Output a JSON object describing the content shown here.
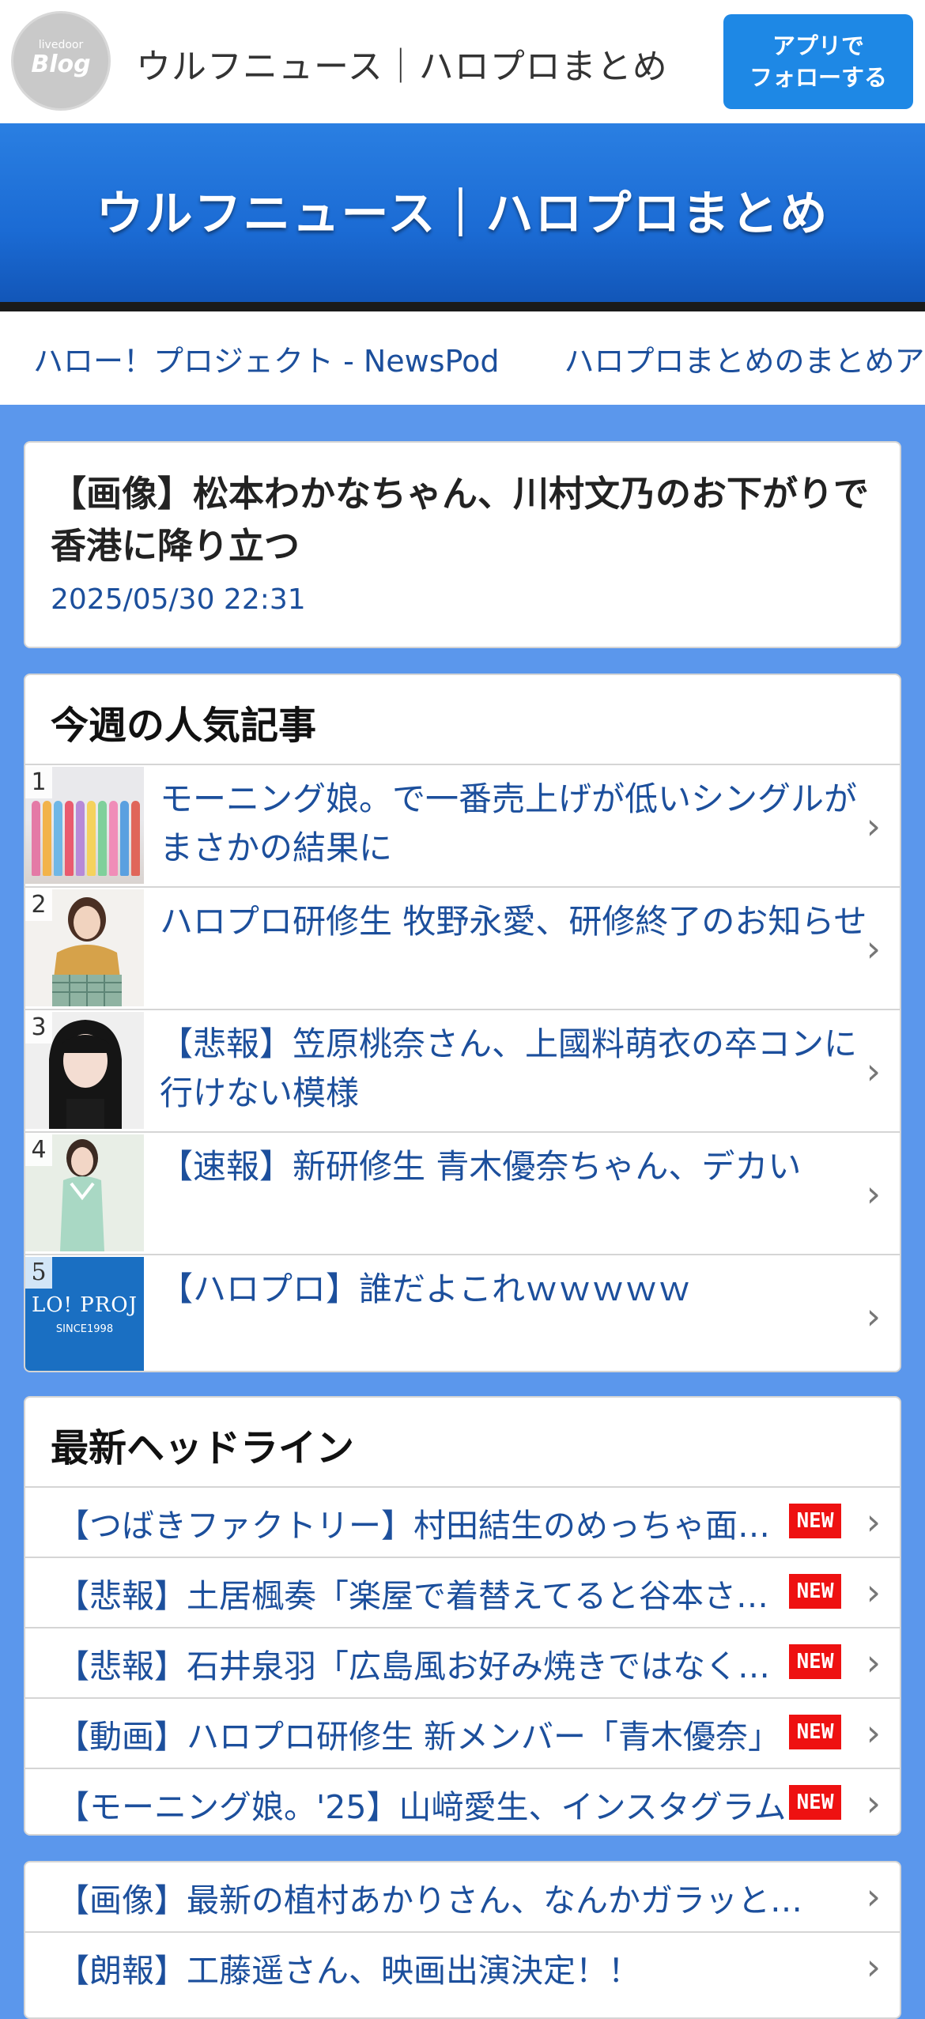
{
  "topbar": {
    "logo_small": "livedoor",
    "logo_big": "Blog",
    "site_name": "ウルフニュース｜ハロプロまとめ",
    "follow_line1": "アプリで",
    "follow_line2": "フォローする"
  },
  "hero": {
    "title": "ウルフニュース｜ハロプロまとめ"
  },
  "nav": {
    "links": [
      "ハロー！プロジェクト - NewsPod",
      "ハロプロまとめのまとめアンテナ"
    ]
  },
  "article": {
    "title": "【画像】松本わかなちゃん、川村文乃のお下がりで香港に降り立つ",
    "date": "2025/05/30 22:31"
  },
  "popular": {
    "title": "今週の人気記事",
    "items": [
      {
        "rank": "1",
        "text": "モーニング娘。で一番売上げが低いシングルがまさかの結果に"
      },
      {
        "rank": "2",
        "text": "ハロプロ研修生 牧野永愛、研修終了のお知らせ"
      },
      {
        "rank": "3",
        "text": "【悲報】笠原桃奈さん、上國料萌衣の卒コンに行けない模様"
      },
      {
        "rank": "4",
        "text": "【速報】新研修生 青木優奈ちゃん、デカい"
      },
      {
        "rank": "5",
        "text": "【ハロプロ】誰だよこれｗｗｗｗｗ"
      }
    ],
    "thumb5_line1": "LO! PROJ",
    "thumb5_line2": "SINCE1998"
  },
  "headlines": {
    "title": "最新ヘッドライン",
    "badge": "NEW",
    "items": [
      "【つばきファクトリー】村田結生のめっちゃ面白い",
      "【悲報】土居楓奏「楽屋で着替えてると谷本さんが",
      "【悲報】石井泉羽「広島風お好み焼きではなく広島",
      "【動画】ハロプロ研修生 新メンバー「青木優奈」",
      "【モーニング娘。'25】山﨑愛生、インスタグラム"
    ]
  },
  "more": {
    "items": [
      "【画像】最新の植村あかりさん、なんかガラッと変わる",
      "【朗報】工藤遥さん、映画出演決定！！"
    ]
  },
  "colors": {
    "page_bg": "#5b97ec",
    "hero_blue": "#1b6bd4",
    "link_blue": "#1c4f9c",
    "follow_btn": "#1e88e5",
    "new_badge": "#ee1111"
  }
}
